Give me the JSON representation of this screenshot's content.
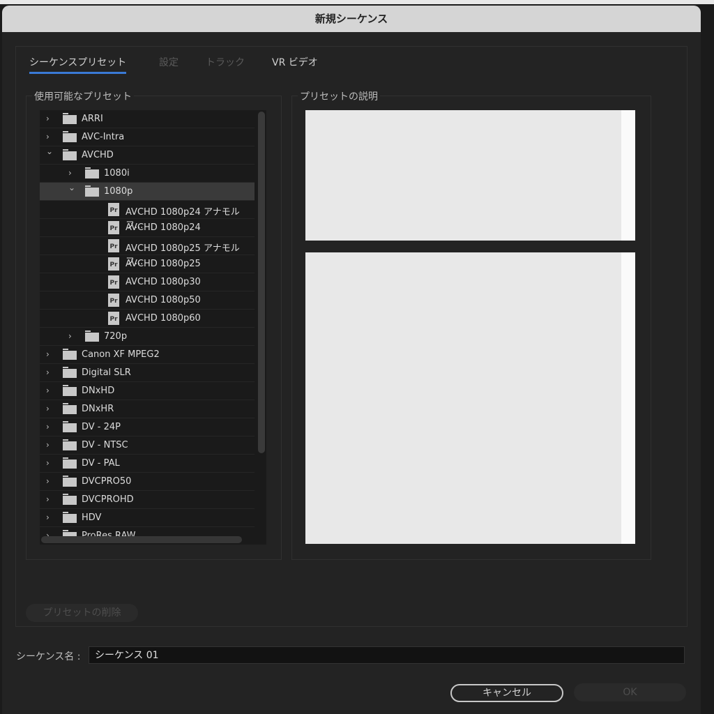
{
  "window": {
    "title": "新規シーケンス"
  },
  "tabs": [
    {
      "label": "シーケンスプリセット",
      "state": "active"
    },
    {
      "label": "設定",
      "state": "disabled"
    },
    {
      "label": "トラック",
      "state": "disabled"
    },
    {
      "label": "VR ビデオ",
      "state": "enabled"
    }
  ],
  "available_presets": {
    "label": "使用可能なプリセット",
    "items": [
      {
        "label": "ARRI",
        "level": 0,
        "type": "folder",
        "expanded": false
      },
      {
        "label": "AVC-Intra",
        "level": 0,
        "type": "folder",
        "expanded": false
      },
      {
        "label": "AVCHD",
        "level": 0,
        "type": "folder",
        "expanded": true
      },
      {
        "label": "1080i",
        "level": 1,
        "type": "folder",
        "expanded": false
      },
      {
        "label": "1080p",
        "level": 1,
        "type": "folder",
        "expanded": true,
        "selected": true
      },
      {
        "label": "AVCHD 1080p24 アナモルフ...",
        "level": 2,
        "type": "preset"
      },
      {
        "label": "AVCHD 1080p24",
        "level": 2,
        "type": "preset"
      },
      {
        "label": "AVCHD 1080p25 アナモルフ...",
        "level": 2,
        "type": "preset"
      },
      {
        "label": "AVCHD 1080p25",
        "level": 2,
        "type": "preset"
      },
      {
        "label": "AVCHD 1080p30",
        "level": 2,
        "type": "preset"
      },
      {
        "label": "AVCHD 1080p50",
        "level": 2,
        "type": "preset"
      },
      {
        "label": "AVCHD 1080p60",
        "level": 2,
        "type": "preset"
      },
      {
        "label": "720p",
        "level": 1,
        "type": "folder",
        "expanded": false
      },
      {
        "label": "Canon XF MPEG2",
        "level": 0,
        "type": "folder",
        "expanded": false
      },
      {
        "label": "Digital SLR",
        "level": 0,
        "type": "folder",
        "expanded": false
      },
      {
        "label": "DNxHD",
        "level": 0,
        "type": "folder",
        "expanded": false
      },
      {
        "label": "DNxHR",
        "level": 0,
        "type": "folder",
        "expanded": false
      },
      {
        "label": "DV - 24P",
        "level": 0,
        "type": "folder",
        "expanded": false
      },
      {
        "label": "DV - NTSC",
        "level": 0,
        "type": "folder",
        "expanded": false
      },
      {
        "label": "DV - PAL",
        "level": 0,
        "type": "folder",
        "expanded": false
      },
      {
        "label": "DVCPRO50",
        "level": 0,
        "type": "folder",
        "expanded": false
      },
      {
        "label": "DVCPROHD",
        "level": 0,
        "type": "folder",
        "expanded": false
      },
      {
        "label": "HDV",
        "level": 0,
        "type": "folder",
        "expanded": false
      },
      {
        "label": "ProRes RAW",
        "level": 0,
        "type": "folder",
        "expanded": false
      }
    ]
  },
  "preset_description": {
    "label": "プリセットの説明"
  },
  "delete_preset_label": "プリセットの削除",
  "sequence_name": {
    "label": "シーケンス名 :",
    "value": "シーケンス 01"
  },
  "cancel_label": "キャンセル",
  "ok_label": "OK",
  "accent_color": "#3a7ad6"
}
